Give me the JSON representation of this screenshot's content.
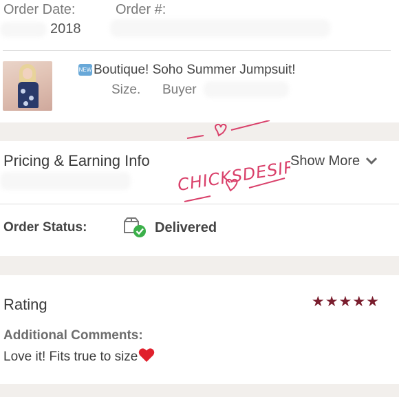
{
  "order": {
    "date_label": "Order Date:",
    "date_value": "2018",
    "number_label": "Order #:"
  },
  "item": {
    "new_badge": "NEW",
    "title": "Boutique! Soho Summer Jumpsuit!",
    "size_label": "Size.",
    "buyer_label": "Buyer"
  },
  "pricing": {
    "title": "Pricing & Earning Info",
    "show_more": "Show More"
  },
  "watermark": {
    "text": "CHICKSDESIRE",
    "color": "#d9406a"
  },
  "status": {
    "label": "Order Status:",
    "value": "Delivered",
    "icon": "delivered-box-check-icon",
    "check_color": "#3bb04a"
  },
  "rating": {
    "label": "Rating",
    "stars": 5,
    "max_stars": 5,
    "star_color": "#7a1e2e",
    "comments_label": "Additional Comments:",
    "comment": "Love it! Fits true to size",
    "comment_emoji": "heart-icon"
  }
}
